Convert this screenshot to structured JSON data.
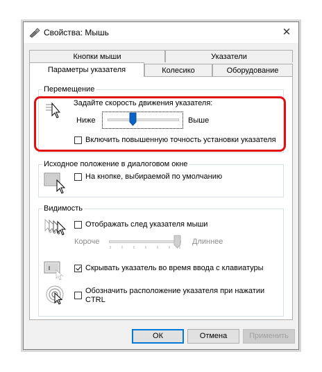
{
  "window": {
    "title": "Свойства: Мышь",
    "close_glyph": "✕",
    "icon": "mouse-properties-icon"
  },
  "tabs": {
    "row1": [
      "Кнопки мыши",
      "Указатели"
    ],
    "row2": [
      "Параметры указателя",
      "Колесико",
      "Оборудование"
    ],
    "active": "Параметры указателя"
  },
  "motion": {
    "group_label": "Перемещение",
    "speed_label": "Задайте скорость движения указателя:",
    "slow_label": "Ниже",
    "fast_label": "Выше",
    "speed_level": 0.5,
    "precision_label": "Включить повышенную точность установки указателя",
    "precision_checked": false
  },
  "snap": {
    "group_label": "Исходное положение в диалоговом окне",
    "snap_label": "На кнопке, выбираемой по умолчанию",
    "snap_checked": false
  },
  "visibility": {
    "group_label": "Видимость",
    "trails_label": "Отображать след указателя мыши",
    "trails_checked": false,
    "short_label": "Короче",
    "long_label": "Длиннее",
    "trails_level": 1.0,
    "hide_label": "Скрывать указатель во время ввода с клавиатуры",
    "hide_checked": true,
    "ctrl_label_line1": "Обозначить расположение указателя при нажатии",
    "ctrl_label_line2": "CTRL",
    "ctrl_checked": false
  },
  "buttons": {
    "ok": "ОК",
    "cancel": "Отмена",
    "apply": "Применить"
  },
  "colors": {
    "highlight": "#e01010",
    "accent": "#0078d7",
    "slider_thumb": "#0a64c8"
  }
}
